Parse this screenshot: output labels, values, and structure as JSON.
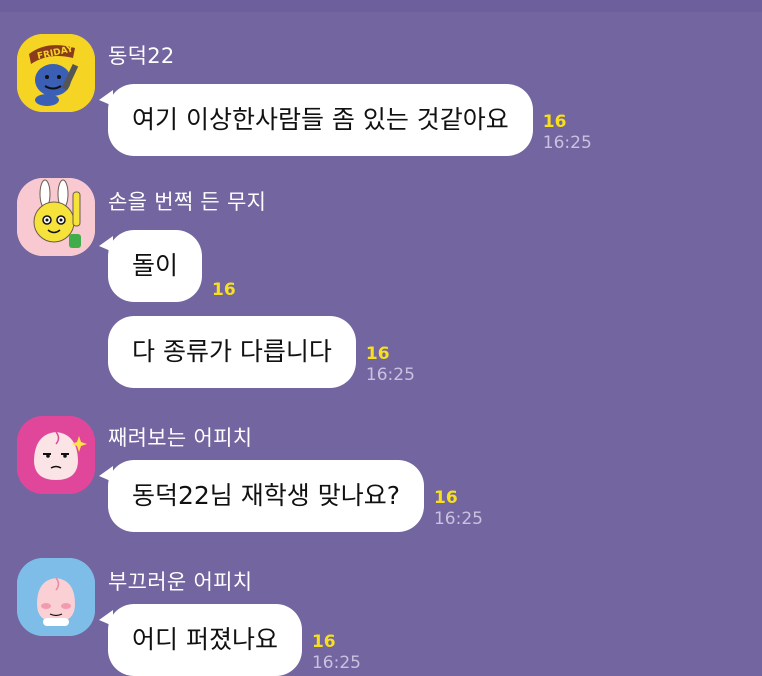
{
  "chat": {
    "messages": [
      {
        "sender": "동덕22",
        "avatar_icon": "ryan-friday-icon",
        "bubbles": [
          {
            "text": "여기 이상한사람들 좀 있는 것같아요",
            "unread": "16",
            "time": "16:25"
          }
        ]
      },
      {
        "sender": "손을 번쩍 든 무지",
        "avatar_icon": "muzi-raising-hand-icon",
        "bubbles": [
          {
            "text": "돌이",
            "unread": "16",
            "time": ""
          },
          {
            "text": "다 종류가 다릅니다",
            "unread": "16",
            "time": "16:25"
          }
        ]
      },
      {
        "sender": "째려보는 어피치",
        "avatar_icon": "apeach-glaring-icon",
        "bubbles": [
          {
            "text": "동덕22님 재학생 맞나요?",
            "unread": "16",
            "time": "16:25"
          }
        ]
      },
      {
        "sender": "부끄러운 어피치",
        "avatar_icon": "apeach-shy-icon",
        "bubbles": [
          {
            "text": "어디 퍼졌나요",
            "unread": "16",
            "time": "16:25"
          }
        ]
      }
    ]
  },
  "colors": {
    "background": "#7265a0",
    "bubble": "#ffffff",
    "unread": "#f8e01c",
    "time": "#c9c2e0",
    "avatar_yellow": "#f5d423",
    "avatar_pink": "#f8c9d0",
    "avatar_magenta": "#e0479b",
    "avatar_blue": "#7dbde8"
  }
}
